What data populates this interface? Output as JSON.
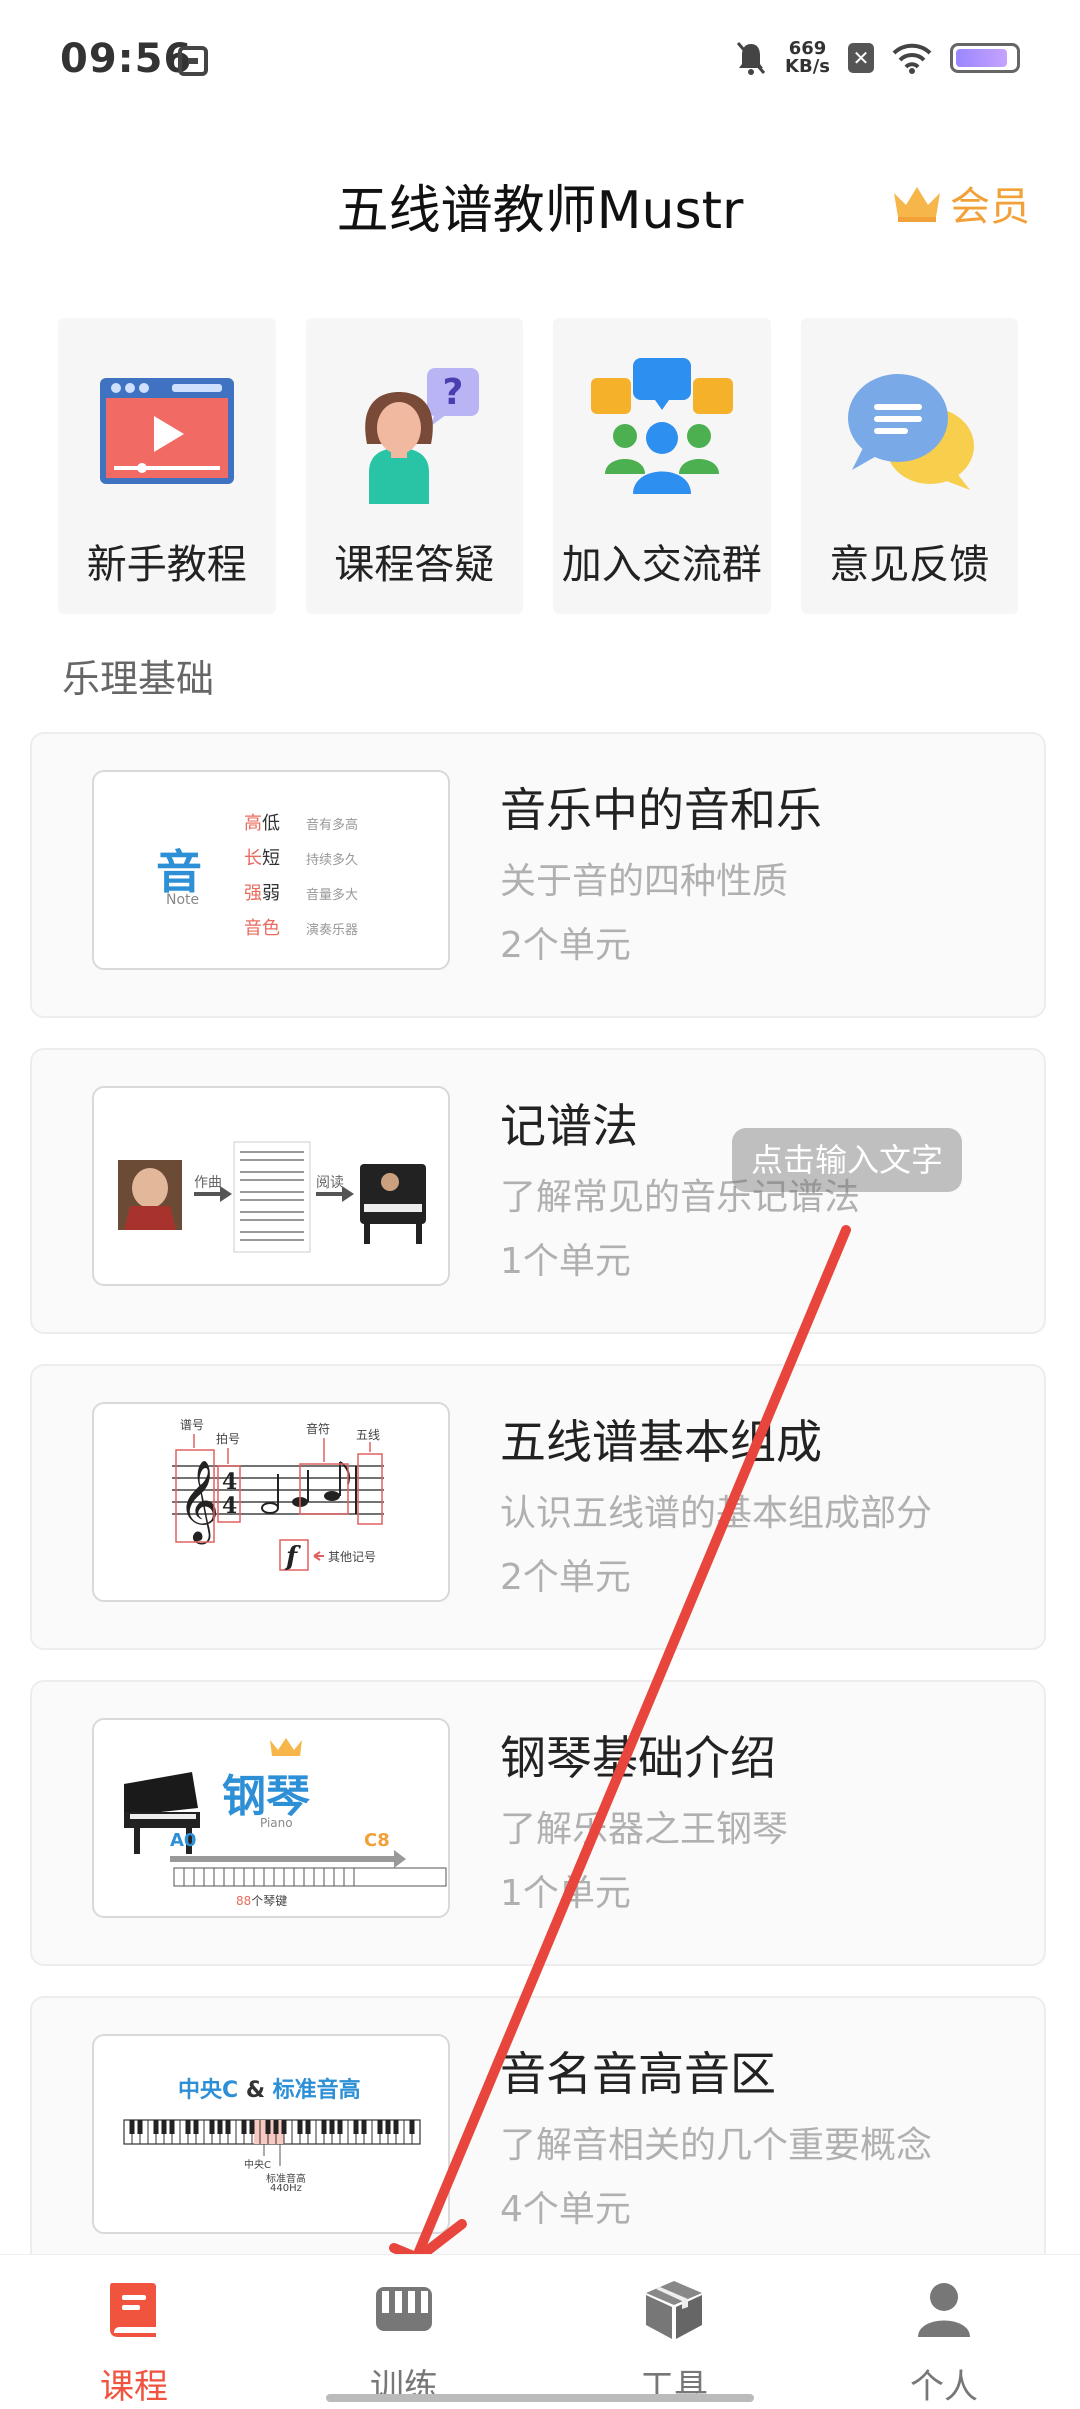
{
  "status_bar": {
    "time": "09:56",
    "net_speed_value": "669",
    "net_speed_unit": "KB/s"
  },
  "header": {
    "title": "五线谱教师Mustr",
    "vip_label": "会员",
    "vip_color": "#f2a038"
  },
  "quick_actions": [
    {
      "label": "新手教程",
      "icon": "video-tutorial-icon"
    },
    {
      "label": "课程答疑",
      "icon": "question-person-icon"
    },
    {
      "label": "加入交流群",
      "icon": "group-chat-icon"
    },
    {
      "label": "意见反馈",
      "icon": "feedback-bubbles-icon"
    }
  ],
  "section_title": "乐理基础",
  "courses": [
    {
      "title": "音乐中的音和乐",
      "subtitle": "关于音的四种性质",
      "units": "2个单元",
      "thumb": {
        "main_char": "音",
        "main_sub": "Note",
        "rows": [
          {
            "a": "高",
            "b": "低",
            "desc": "音有多高"
          },
          {
            "a": "长",
            "b": "短",
            "desc": "持续多久"
          },
          {
            "a": "强",
            "b": "弱",
            "desc": "音量多大"
          },
          {
            "a": "音",
            "b": "色",
            "desc": "演奏乐器"
          }
        ]
      }
    },
    {
      "title": "记谱法",
      "subtitle": "了解常见的音乐记谱法",
      "units": "1个单元",
      "thumb": {
        "step1": "作曲",
        "step2": "阅读"
      }
    },
    {
      "title": "五线谱基本组成",
      "subtitle": "认识五线谱的基本组成部分",
      "units": "2个单元",
      "thumb": {
        "l1": "谱号",
        "l2": "拍号",
        "l3": "音符",
        "l4": "五线",
        "l5": "其他记号"
      }
    },
    {
      "title": "钢琴基础介绍",
      "subtitle": "了解乐器之王钢琴",
      "units": "1个单元",
      "thumb": {
        "name": "钢琴",
        "en": "Piano",
        "low": "A0",
        "high": "C8",
        "keys_num": "88",
        "keys_text": "个琴键"
      }
    },
    {
      "title": "音名音高音区",
      "subtitle": "了解音相关的几个重要概念",
      "units": "4个单元",
      "thumb": {
        "t1": "中央C",
        "amp": " & ",
        "t2": "标准音高",
        "l1": "中央C",
        "l2": "标准音高",
        "l3": "440Hz"
      }
    }
  ],
  "overlay_tip": "点击输入文字",
  "tabs": [
    {
      "label": "课程",
      "icon": "book-icon",
      "active": true
    },
    {
      "label": "训练",
      "icon": "piano-keys-icon",
      "active": false
    },
    {
      "label": "工具",
      "icon": "box-icon",
      "active": false
    },
    {
      "label": "个人",
      "icon": "person-icon",
      "active": false
    }
  ],
  "colors": {
    "accent": "#f0533e",
    "inactive_tab": "#777777",
    "annotation_arrow": "#e8453c"
  }
}
